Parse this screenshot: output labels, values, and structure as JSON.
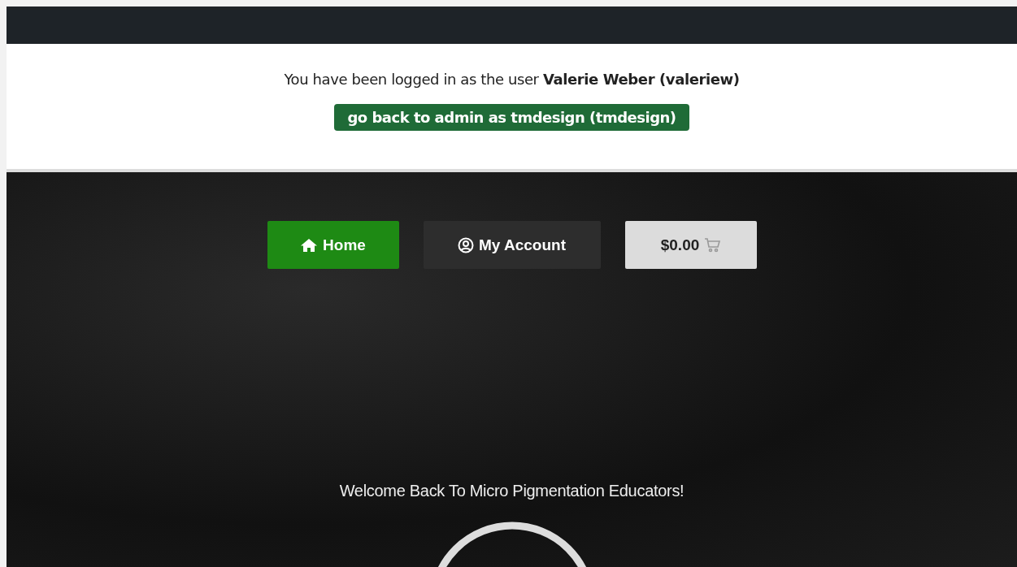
{
  "notice": {
    "message": "You have been logged in as the user **Valerie Weber (valeriew)**",
    "button": "go back to admin as tmdesign (tmdesign)"
  },
  "nav": [
    {
      "kind": "home",
      "label": "Home"
    },
    {
      "kind": "account",
      "label": "My Account"
    },
    {
      "kind": "cart",
      "label": "$0.00"
    }
  ],
  "hero": {
    "heading": "Welcome Back To Micro Pigmentation Educators!"
  }
}
